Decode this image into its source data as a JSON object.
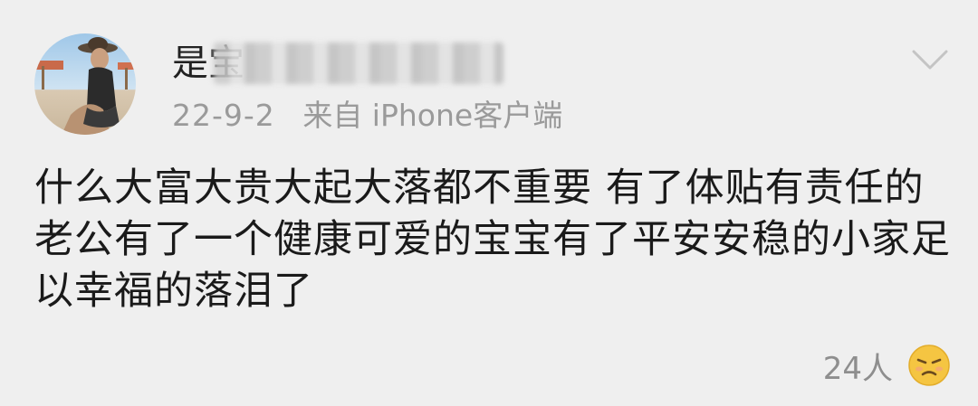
{
  "comment": {
    "username": "是宝",
    "date": "22-9-2",
    "source": "来自 iPhone客户端",
    "text": "什么大富大贵大起大落都不重要 有了体贴有责任的老公有了一个健康可爱的宝宝有了平安安稳的小家足以幸福的落泪了",
    "likes": "24人",
    "reaction_icon": "crying-face-emoji-icon",
    "menu_icon": "chevron-down-icon"
  },
  "colors": {
    "background": "#efefef",
    "text": "#1a1a1a",
    "meta": "#9a9a9a",
    "emoji": "#f5c542"
  }
}
